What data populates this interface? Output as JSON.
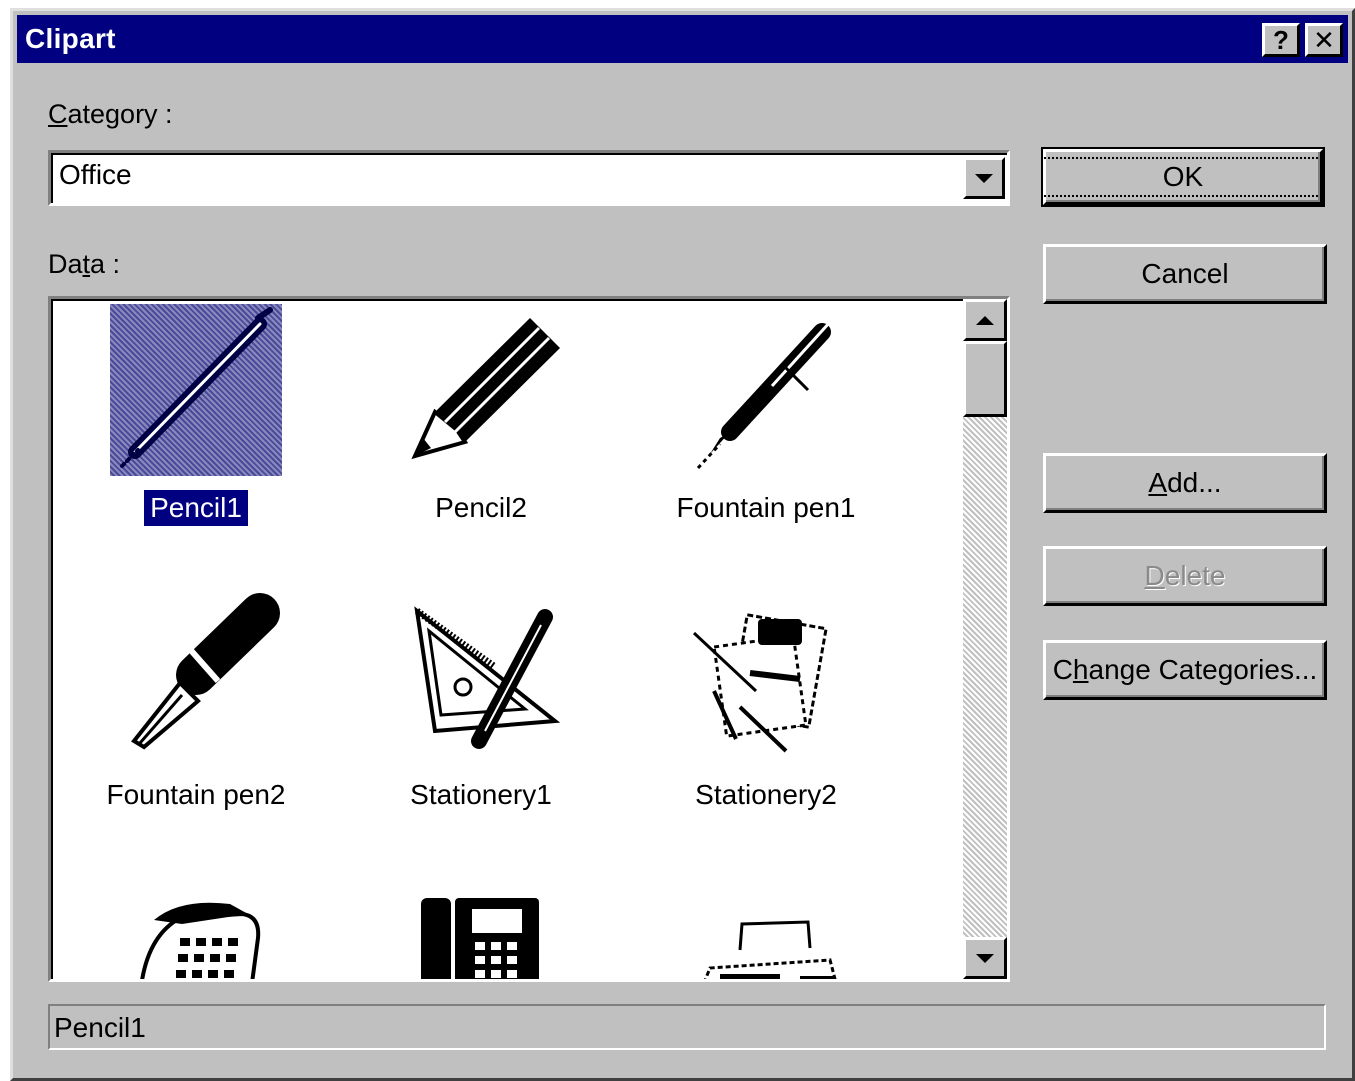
{
  "window": {
    "title": "Clipart",
    "help_glyph": "?",
    "close_glyph": "✕"
  },
  "category": {
    "label": "Category :",
    "label_accel": "C",
    "label_rest": "ategory :",
    "value": "Office"
  },
  "data_list": {
    "label_pre": "Da",
    "label_accel": "t",
    "label_rest": "a :",
    "items": [
      {
        "caption": "Pencil1",
        "icon": "pencil-icon",
        "selected": true
      },
      {
        "caption": "Pencil2",
        "icon": "pencil-icon",
        "selected": false
      },
      {
        "caption": "Fountain pen1",
        "icon": "fountain-pen-icon",
        "selected": false
      },
      {
        "caption": "Fountain pen2",
        "icon": "fountain-pen-nib-icon",
        "selected": false
      },
      {
        "caption": "Stationery1",
        "icon": "set-square-pencil-icon",
        "selected": false
      },
      {
        "caption": "Stationery2",
        "icon": "stationery-icon",
        "selected": false
      },
      {
        "caption": "",
        "icon": "telephone-icon",
        "selected": false
      },
      {
        "caption": "",
        "icon": "desk-phone-icon",
        "selected": false
      },
      {
        "caption": "",
        "icon": "fax-machine-icon",
        "selected": false
      }
    ]
  },
  "buttons": {
    "ok": "OK",
    "cancel": "Cancel",
    "add_accel": "A",
    "add_rest": "dd...",
    "delete_accel": "D",
    "delete_rest": "elete",
    "change_pre": "C",
    "change_accel": "h",
    "change_rest": "ange Categories..."
  },
  "status": {
    "value": "Pencil1"
  },
  "colors": {
    "face": "#c0c0c0",
    "title_bar": "#000080",
    "selection": "#000080"
  }
}
